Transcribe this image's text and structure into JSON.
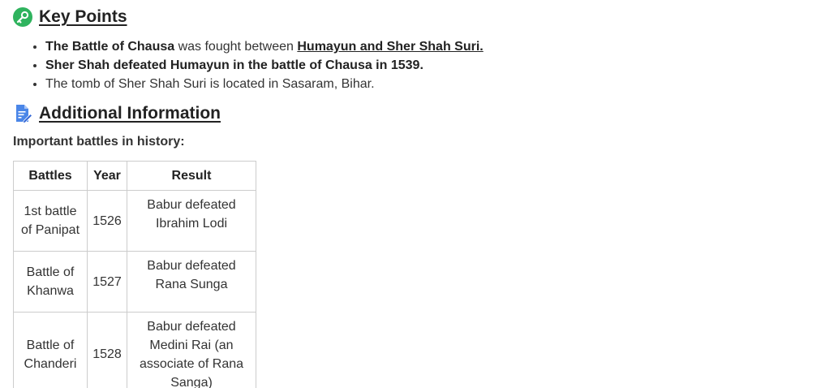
{
  "key_points": {
    "title": "Key Points",
    "items": [
      {
        "bold": "The Battle of Chausa",
        "text": " was fought between ",
        "link": "Humayun and Sher Shah Suri."
      },
      {
        "bold": "Sher Shah defeated Humayun in the battle of Chausa in 1539."
      },
      {
        "text": "The tomb of Sher Shah Suri is located in Sasaram, Bihar."
      }
    ]
  },
  "additional_info": {
    "title": "Additional Information",
    "subheading": "Important battles in history:"
  },
  "table": {
    "headers": [
      "Battles",
      "Year",
      "Result"
    ],
    "rows": [
      {
        "battle": [
          "1st battle",
          "of Panipat"
        ],
        "year": "1526",
        "result": [
          "Babur defeated",
          "Ibrahim Lodi"
        ]
      },
      {
        "battle": [
          "Battle of",
          "Khanwa"
        ],
        "year": "1527",
        "result": [
          "Babur defeated",
          "Rana Sunga"
        ]
      },
      {
        "battle": [
          "Battle of",
          "Chanderi"
        ],
        "year": "1528",
        "result": [
          "Babur defeated",
          "Medini Rai (an",
          "associate of Rana",
          "Sanga)"
        ]
      }
    ]
  },
  "icons": {
    "key_points": "key-icon",
    "additional_info": "document-edit-icon"
  },
  "colors": {
    "key_icon": "#2fb35e",
    "doc_icon": "#4a86e8"
  }
}
